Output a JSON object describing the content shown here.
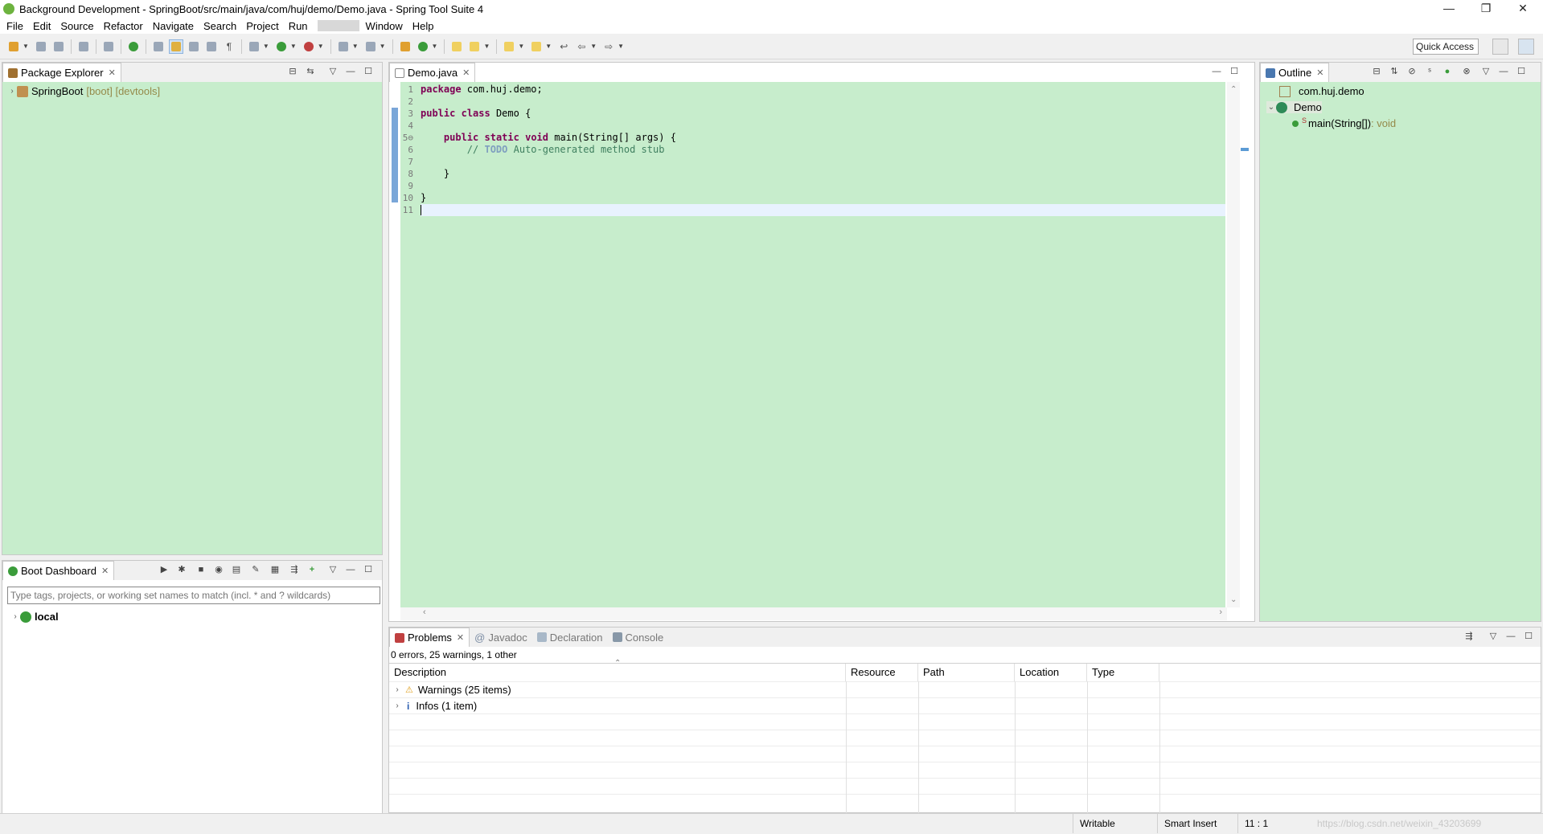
{
  "window": {
    "title": "Background Development - SpringBoot/src/main/java/com/huj/demo/Demo.java - Spring Tool Suite 4",
    "controls": [
      "—",
      "❐",
      "✕"
    ]
  },
  "menu": {
    "items_left": [
      "File",
      "Edit",
      "Source",
      "Refactor",
      "Navigate",
      "Search",
      "Project",
      "Run"
    ],
    "items_right": [
      "Window",
      "Help"
    ]
  },
  "toolbar": {
    "quick_access": "Quick Access"
  },
  "package_explorer": {
    "tab_label": "Package Explorer",
    "project_name": "SpringBoot",
    "project_decorations": "[boot] [devtools]"
  },
  "boot_dashboard": {
    "tab_label": "Boot Dashboard",
    "filter_placeholder": "Type tags, projects, or working set names to match (incl. * and ? wildcards)",
    "local_label": "local"
  },
  "editor": {
    "tab_label": "Demo.java",
    "lines": [
      {
        "n": "1",
        "parts": [
          {
            "t": "package",
            "c": "kw"
          },
          {
            "t": " com.huj.demo;",
            "c": "plain"
          }
        ]
      },
      {
        "n": "2",
        "parts": []
      },
      {
        "n": "3",
        "parts": [
          {
            "t": "public",
            "c": "kw"
          },
          {
            "t": " ",
            "c": "plain"
          },
          {
            "t": "class",
            "c": "kw"
          },
          {
            "t": " Demo {",
            "c": "plain"
          }
        ]
      },
      {
        "n": "4",
        "parts": []
      },
      {
        "n": "5⊖",
        "parts": [
          {
            "t": "    ",
            "c": "plain"
          },
          {
            "t": "public",
            "c": "kw"
          },
          {
            "t": " ",
            "c": "plain"
          },
          {
            "t": "static",
            "c": "kw"
          },
          {
            "t": " ",
            "c": "plain"
          },
          {
            "t": "void",
            "c": "kw"
          },
          {
            "t": " main(String[] args) {",
            "c": "plain"
          }
        ]
      },
      {
        "n": "6",
        "parts": [
          {
            "t": "        // ",
            "c": "cm"
          },
          {
            "t": "TODO",
            "c": "todo"
          },
          {
            "t": " Auto-generated method stub",
            "c": "cm"
          }
        ]
      },
      {
        "n": "7",
        "parts": []
      },
      {
        "n": "8",
        "parts": [
          {
            "t": "    }",
            "c": "plain"
          }
        ]
      },
      {
        "n": "9",
        "parts": []
      },
      {
        "n": "10",
        "parts": [
          {
            "t": "}",
            "c": "plain"
          }
        ]
      },
      {
        "n": "11",
        "parts": []
      }
    ]
  },
  "outline": {
    "tab_label": "Outline",
    "package": "com.huj.demo",
    "class_name": "Demo",
    "method": "main(String[])",
    "method_type": " : void"
  },
  "problems": {
    "tabs": [
      "Problems",
      "Javadoc",
      "Declaration",
      "Console"
    ],
    "summary": "0 errors, 25 warnings, 1 other",
    "columns": [
      "Description",
      "Resource",
      "Path",
      "Location",
      "Type"
    ],
    "rows": [
      "Warnings (25 items)",
      "Infos (1 item)"
    ]
  },
  "status": {
    "writable": "Writable",
    "insert_mode": "Smart Insert",
    "position": "11 : 1",
    "watermark": "https://blog.csdn.net/weixin_43203699"
  }
}
